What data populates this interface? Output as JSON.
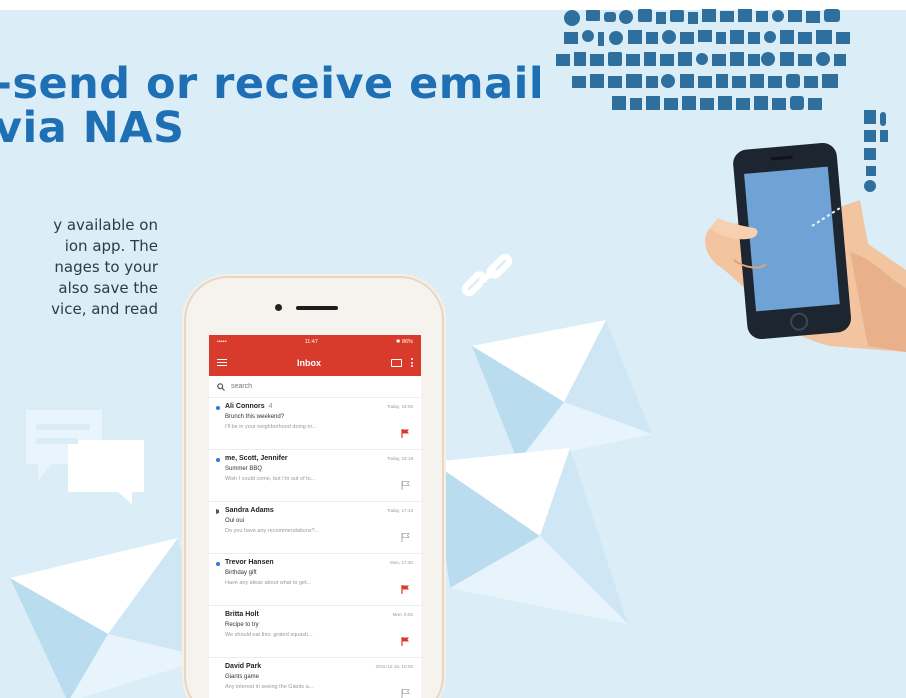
{
  "heading": {
    "line1": "-send or receive email",
    "line2": "via NAS"
  },
  "body": {
    "lines": [
      "y available on",
      "ion app. The",
      "nages to your",
      "also save the",
      "vice, and read"
    ]
  },
  "phone": {
    "status": {
      "carrier": "••••• ",
      "time": "11:47",
      "battery": "✱ 86%"
    },
    "appbar": {
      "title": "Inbox"
    },
    "search": {
      "placeholder": "search"
    },
    "emails": [
      {
        "from": "Ali Connors",
        "count": "4",
        "time": "Today, 19:00",
        "subject": "Brunch this weekend?",
        "preview": "I'll be in your neighborhood doing er...",
        "flagged": true,
        "marker": "unread"
      },
      {
        "from": "me, Scott, Jennifer",
        "count": "",
        "time": "Today, 19:19",
        "subject": "Summer BBQ",
        "preview": "Wish I could come, but I'm out of to...",
        "flagged": false,
        "marker": "unread"
      },
      {
        "from": "Sandra Adams",
        "count": "",
        "time": "Today, 17:13",
        "subject": "Oui oui",
        "preview": "Do you have any recommendations?...",
        "flagged": false,
        "marker": "reply"
      },
      {
        "from": "Trevor Hansen",
        "count": "",
        "time": "Mon, 17:30",
        "subject": "Birthday gift",
        "preview": "Have any ideas about what to get...",
        "flagged": true,
        "marker": "unread"
      },
      {
        "from": "Britta Holt",
        "count": "",
        "time": "Mon, 9:03",
        "subject": "Recipe to try",
        "preview": "We should eat this: grated squash...",
        "flagged": true,
        "marker": "none"
      },
      {
        "from": "David Park",
        "count": "",
        "time": "2015-12-15, 10:00",
        "subject": "Giants game",
        "preview": "Any interest in seeing the Giants a...",
        "flagged": false,
        "marker": "none"
      }
    ]
  },
  "colors": {
    "background": "#dbeef8",
    "heading": "#1f6fb5",
    "brand_red": "#d83b2b",
    "envelope": "#e8f4fb",
    "envelope_shade": "#b9dcef",
    "icon_cloud": "#2e6f9e"
  },
  "icons": [
    "link-icon",
    "chat-bubble-icon",
    "envelope-icon",
    "icon-cloud",
    "hand-holding-phone"
  ]
}
